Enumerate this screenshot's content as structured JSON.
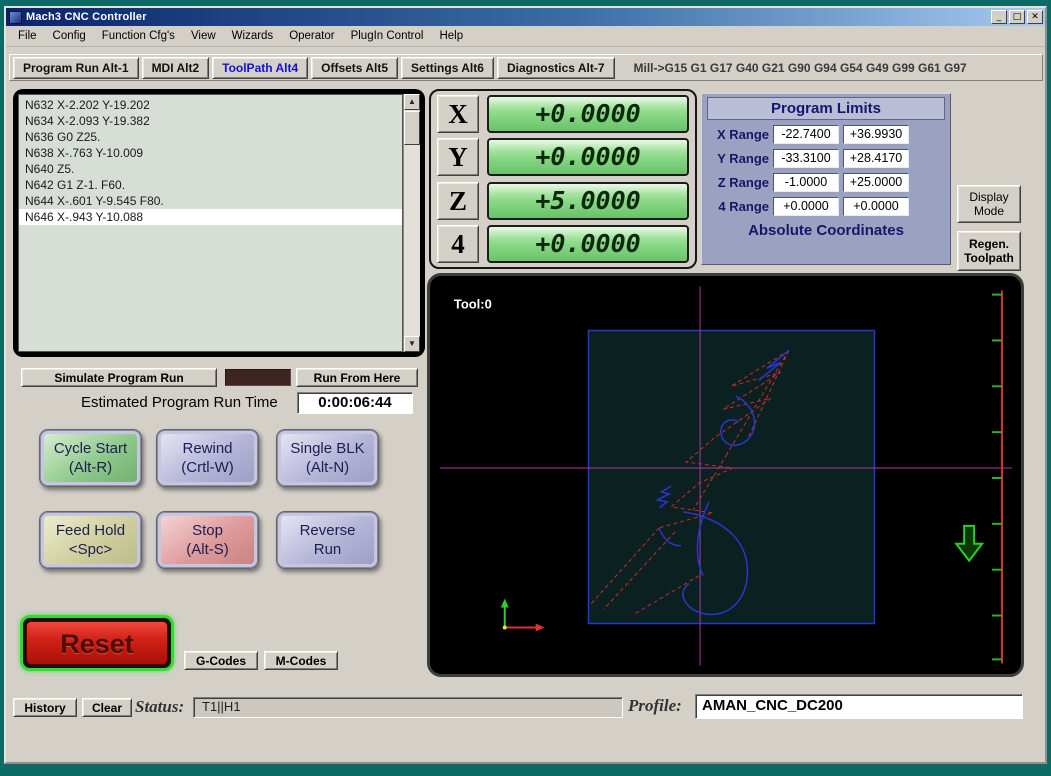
{
  "window": {
    "title": "Mach3 CNC Controller",
    "menu": [
      "File",
      "Config",
      "Function Cfg's",
      "View",
      "Wizards",
      "Operator",
      "PlugIn Control",
      "Help"
    ],
    "controls": {
      "minimize": "_",
      "maximize": "□",
      "close": "✕"
    }
  },
  "tabs": [
    {
      "label": "Program Run Alt-1"
    },
    {
      "label": "MDI Alt2"
    },
    {
      "label": "ToolPath Alt4"
    },
    {
      "label": "Offsets Alt5"
    },
    {
      "label": "Settings Alt6"
    },
    {
      "label": "Diagnostics Alt-7"
    }
  ],
  "modal_line": "Mill->G15  G1 G17 G40 G21 G90 G94 G54 G49 G99 G61 G97",
  "gcode": {
    "lines": [
      "N632 X-2.202 Y-19.202",
      "N634 X-2.093 Y-19.382",
      "N636 G0 Z25.",
      "N638 X-.763 Y-10.009",
      "N640 Z5.",
      "N642 G1 Z-1. F60.",
      "N644 X-.601 Y-9.545 F80.",
      "N646 X-.943 Y-10.088"
    ]
  },
  "dro": {
    "axes": [
      {
        "label": "X",
        "value": "+0.0000"
      },
      {
        "label": "Y",
        "value": "+0.0000"
      },
      {
        "label": "Z",
        "value": "+5.0000"
      },
      {
        "label": "4",
        "value": "+0.0000"
      }
    ]
  },
  "limits": {
    "title": "Program Limits",
    "rows": [
      {
        "label": "X Range",
        "min": "-22.7400",
        "max": "+36.9930"
      },
      {
        "label": "Y Range",
        "min": "-33.3100",
        "max": "+28.4170"
      },
      {
        "label": "Z Range",
        "min": "-1.0000",
        "max": "+25.0000"
      },
      {
        "label": "4 Range",
        "min": "+0.0000",
        "max": "+0.0000"
      }
    ],
    "footer": "Absolute Coordinates"
  },
  "side_buttons": {
    "display_mode_1": "Display",
    "display_mode_2": "Mode",
    "regen_1": "Regen.",
    "regen_2": "Toolpath"
  },
  "run": {
    "simulate": "Simulate Program Run",
    "run_from_here": "Run From Here",
    "estimated_label": "Estimated Program Run Time",
    "estimated_value": "0:00:06:44"
  },
  "controls": [
    {
      "line1": "Cycle Start",
      "line2": "(Alt-R)"
    },
    {
      "line1": "Rewind",
      "line2": "(Crtl-W)"
    },
    {
      "line1": "Single BLK",
      "line2": "(Alt-N)"
    },
    {
      "line1": "Feed Hold",
      "line2": "<Spc>"
    },
    {
      "line1": "Stop",
      "line2": "(Alt-S)"
    },
    {
      "line1": "Reverse",
      "line2": "Run"
    }
  ],
  "reset_label": "Reset",
  "code_buttons": {
    "gcodes": "G-Codes",
    "mcodes": "M-Codes"
  },
  "toolpath": {
    "tool_label": "Tool:0"
  },
  "statusbar": {
    "history": "History",
    "clear": "Clear",
    "status_label": "Status:",
    "status_value": "T1||H1",
    "profile_label": "Profile:",
    "profile_value": "AMAN_CNC_DC200"
  },
  "icons": {
    "scroll_up": "▲",
    "scroll_down": "▼"
  },
  "colors": {
    "dro_green": "#8ad987",
    "limits_bg": "#9ba1c0",
    "active_tab_blue": "#1212d4",
    "reset_red": "#cf1f16",
    "reset_ring_green": "#2fdd2f"
  }
}
